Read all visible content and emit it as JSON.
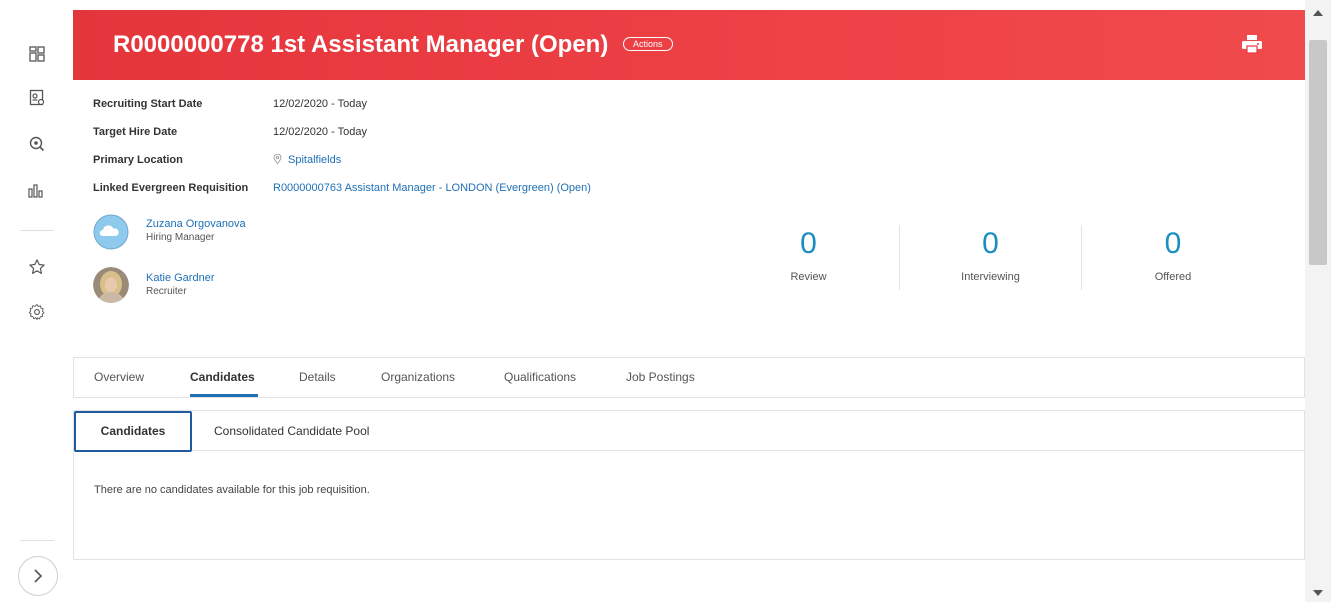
{
  "rail": {
    "items": [
      {
        "name": "apps-grid-icon"
      },
      {
        "name": "job-profile-icon"
      },
      {
        "name": "search-icon"
      },
      {
        "name": "analytics-icon"
      },
      {
        "name": "star-icon"
      },
      {
        "name": "gear-icon"
      }
    ],
    "expand_icon": "chevron-right-icon"
  },
  "header": {
    "title": "R0000000778 1st Assistant Manager (Open)",
    "actions_label": "Actions",
    "color": "#e9393e"
  },
  "info": {
    "recruiting_start_label": "Recruiting Start Date",
    "recruiting_start_value": "12/02/2020 - Today",
    "target_hire_label": "Target Hire Date",
    "target_hire_value": "12/02/2020 - Today",
    "primary_location_label": "Primary Location",
    "primary_location_value": "Spitalfields",
    "linked_req_label": "Linked Evergreen Requisition",
    "linked_req_value": "R0000000763 Assistant Manager - LONDON (Evergreen) (Open)"
  },
  "people": [
    {
      "name": "Zuzana Orgovanova",
      "role": "Hiring Manager"
    },
    {
      "name": "Katie Gardner",
      "role": "Recruiter"
    }
  ],
  "stats": [
    {
      "value": "0",
      "label": "Review"
    },
    {
      "value": "0",
      "label": "Interviewing"
    },
    {
      "value": "0",
      "label": "Offered"
    }
  ],
  "tabs": [
    "Overview",
    "Candidates",
    "Details",
    "Organizations",
    "Qualifications",
    "Job Postings"
  ],
  "subtabs": [
    "Candidates",
    "Consolidated Candidate Pool"
  ],
  "empty_message": "There are no candidates available for this job requisition.",
  "colors": {
    "accent": "#1f6fb5",
    "stat": "#1a8fbf"
  }
}
